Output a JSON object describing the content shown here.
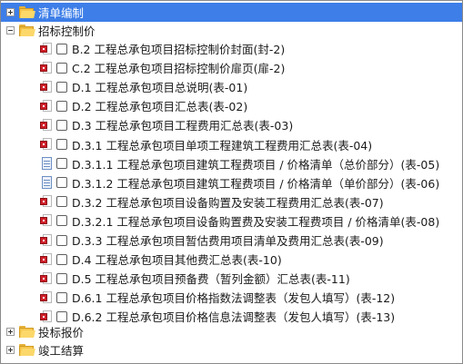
{
  "tree": {
    "root": {
      "label": "清单编制",
      "expanded": false
    },
    "group_zbkzj": {
      "label": "招标控制价",
      "expanded": true
    },
    "items": [
      {
        "label": "B.2 工程总承包项目招标控制价封面(封-2)",
        "icon": "red-doc-icon"
      },
      {
        "label": "C.2 工程总承包项目招标控制价扉页(扉-2)",
        "icon": "red-doc-icon"
      },
      {
        "label": "D.1 工程总承包项目总说明(表-01)",
        "icon": "red-doc-icon"
      },
      {
        "label": "D.2 工程总承包项目汇总表(表-02)",
        "icon": "red-doc-icon"
      },
      {
        "label": "D.3 工程总承包项目工程费用汇总表(表-03)",
        "icon": "red-doc-icon"
      },
      {
        "label": "D.3.1 工程总承包项目单项工程建筑工程费用汇总表(表-04)",
        "icon": "red-doc-icon"
      },
      {
        "label": "D.3.1.1 工程总承包项目建筑工程费项目 / 价格清单（总价部分）(表-05)",
        "icon": "blue-doc-icon"
      },
      {
        "label": "D.3.1.2 工程总承包项目建筑工程费项目 / 价格清单（单价部分）(表-06)",
        "icon": "blue-doc-icon"
      },
      {
        "label": "D.3.2 工程总承包项目设备购置及安装工程费用汇总表(表-07)",
        "icon": "red-doc-icon"
      },
      {
        "label": "D.3.2.1 工程总承包项目设备购置费及安装工程费项目 / 价格清单(表-08)",
        "icon": "red-doc-icon"
      },
      {
        "label": "D.3.3 工程总承包项目暂估费用项目清单及费用汇总表(表-09)",
        "icon": "red-doc-icon"
      },
      {
        "label": "D.4 工程总承包项目其他费汇总表(表-10)",
        "icon": "red-doc-icon"
      },
      {
        "label": "D.5 工程总承包项目预备费（暂列金额）汇总表(表-11)",
        "icon": "red-doc-icon"
      },
      {
        "label": "D.6.1 工程总承包项目价格指数法调整表（发包人填写）(表-12)",
        "icon": "red-doc-icon"
      },
      {
        "label": "D.6.2 工程总承包项目价格信息法调整表（发包人填写）(表-13)",
        "icon": "red-doc-icon"
      }
    ],
    "group_tbbj": {
      "label": "投标报价",
      "expanded": false
    },
    "group_jgjs": {
      "label": "竣工结算",
      "expanded": false
    }
  },
  "colors": {
    "selection": "#3d7ee8",
    "folder": "#f5c64c",
    "red_icon": "#d0202a",
    "blue_icon": "#6d8fc4"
  }
}
